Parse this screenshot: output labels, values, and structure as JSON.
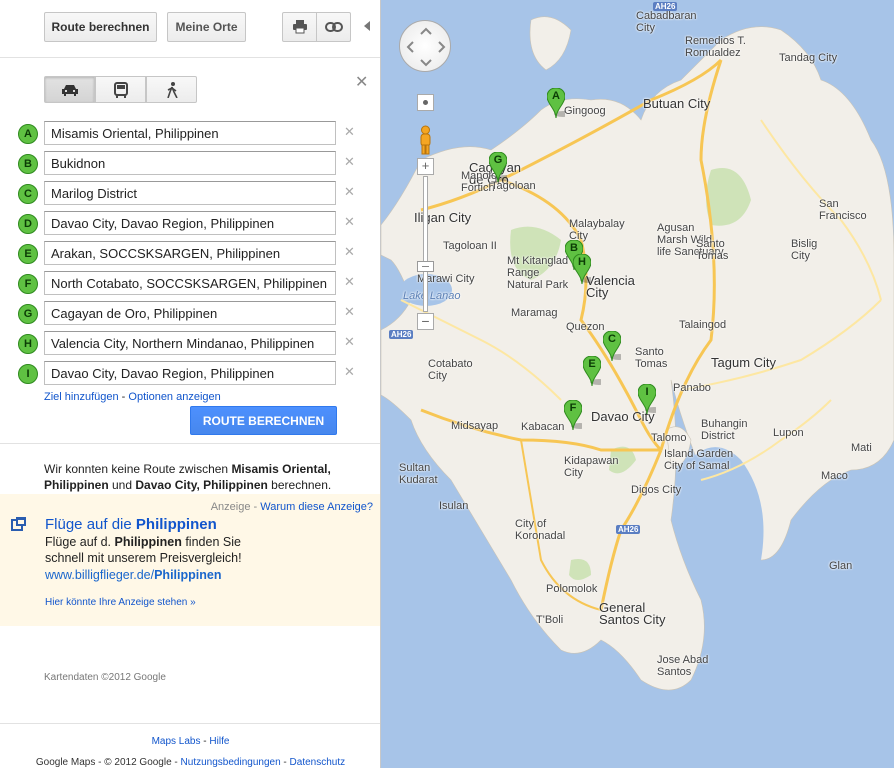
{
  "toolbar": {
    "route_label": "Route berechnen",
    "places_label": "Meine Orte",
    "print_icon": "print-icon",
    "link_icon": "link-icon",
    "collapse_icon": "collapse-left-icon"
  },
  "modes": [
    {
      "icon": "car-icon",
      "active": true
    },
    {
      "icon": "bus-icon",
      "active": false
    },
    {
      "icon": "walk-icon",
      "active": false
    }
  ],
  "waypoints": [
    {
      "letter": "A",
      "value": "Misamis Oriental, Philippinen"
    },
    {
      "letter": "B",
      "value": "Bukidnon"
    },
    {
      "letter": "C",
      "value": "Marilog District"
    },
    {
      "letter": "D",
      "value": "Davao City, Davao Region, Philippinen"
    },
    {
      "letter": "E",
      "value": "Arakan, SOCCSKSARGEN, Philippinen"
    },
    {
      "letter": "F",
      "value": "North Cotabato, SOCCSKSARGEN, Philippinen"
    },
    {
      "letter": "G",
      "value": "Cagayan de Oro, Philippinen"
    },
    {
      "letter": "H",
      "value": "Valencia City, Northern Mindanao, Philippinen"
    },
    {
      "letter": "I",
      "value": "Davao City, Davao Region, Philippinen"
    }
  ],
  "links": {
    "add_destination": "Ziel hinzufügen",
    "dash": "-",
    "show_options": "Optionen anzeigen"
  },
  "route_button": "ROUTE BERECHNEN",
  "message": {
    "part1": "Wir konnten keine Route zwischen ",
    "from": "Misamis Oriental, Philippinen",
    "part2": " und ",
    "to": "Davao City, Philippinen",
    "part3": " berechnen."
  },
  "ad": {
    "label": "Anzeige",
    "dash": "-",
    "why": "Warum diese Anzeige?",
    "title_prefix": "Flüge auf die ",
    "title_bold": "Philippinen",
    "text1": "Flüge auf d. ",
    "text_bold": "Philippinen",
    "text2": " finden Sie schnell mit unserem Preisvergleich!",
    "url_prefix": "www.billigflieger.de/",
    "url_bold": "Philippinen",
    "your_ad": "Hier könnte Ihre Anzeige stehen »",
    "icon": "external-window-icon"
  },
  "map_data_credit": "Kartendaten ©2012 Google",
  "footer": {
    "labs": "Maps Labs",
    "dash": "-",
    "help": "Hilfe",
    "copyright": "Google Maps - © 2012 Google - ",
    "terms": "Nutzungsbedingungen",
    "privacy": "Datenschutz"
  },
  "map": {
    "labels": [
      {
        "text": "Cagayan\nde Oro",
        "big": true
      },
      {
        "text": "Iligan City",
        "big": true
      },
      {
        "text": "Butuan City",
        "big": true
      },
      {
        "text": "Malaybalay\nCity"
      },
      {
        "text": "Valencia\nCity",
        "big": true
      },
      {
        "text": "Davao City",
        "big": true
      },
      {
        "text": "Tagum City",
        "big": true
      },
      {
        "text": "General\nSantos City",
        "big": true
      },
      {
        "text": "Cotabato\nCity"
      },
      {
        "text": "Lake Lanao",
        "water": true
      },
      {
        "text": "Gingoog"
      },
      {
        "text": "Cabadbaran\nCity"
      },
      {
        "text": "Remedios T.\nRomualdez"
      },
      {
        "text": "Tandag City"
      },
      {
        "text": "San\nFrancisco"
      },
      {
        "text": "Agusan\nMarsh Wild\nlife Sanctuary"
      },
      {
        "text": "Santo\nTomas"
      },
      {
        "text": "Bislig\nCity"
      },
      {
        "text": "Mt Kitanglad\nRange\nNatural Park"
      },
      {
        "text": "Tagoloan II"
      },
      {
        "text": "Marawi City"
      },
      {
        "text": "Maramag"
      },
      {
        "text": "Quezon"
      },
      {
        "text": "Talaingod"
      },
      {
        "text": "Santo\nTomas"
      },
      {
        "text": "Panabo"
      },
      {
        "text": "Buhangin\nDistrict"
      },
      {
        "text": "Talomo"
      },
      {
        "text": "Island Garden\nCity of Samal"
      },
      {
        "text": "Lupon"
      },
      {
        "text": "Digos City"
      },
      {
        "text": "Kidapawan\nCity"
      },
      {
        "text": "Kabacan"
      },
      {
        "text": "Midsayap"
      },
      {
        "text": "Sultan\nKudarat"
      },
      {
        "text": "Isulan"
      },
      {
        "text": "City of\nKoronadal"
      },
      {
        "text": "Polomolok"
      },
      {
        "text": "T'Boli"
      },
      {
        "text": "Glan"
      },
      {
        "text": "Jose Abad\nSantos"
      },
      {
        "text": "Mati"
      },
      {
        "text": "Manolo\nFortich"
      },
      {
        "text": "Tagoloan"
      },
      {
        "text": "Maco"
      }
    ],
    "highway": "AH26",
    "highway2": "AH26",
    "highway3": "AH26",
    "pins": [
      "A",
      "B",
      "G",
      "H",
      "C",
      "E",
      "I",
      "F"
    ]
  }
}
